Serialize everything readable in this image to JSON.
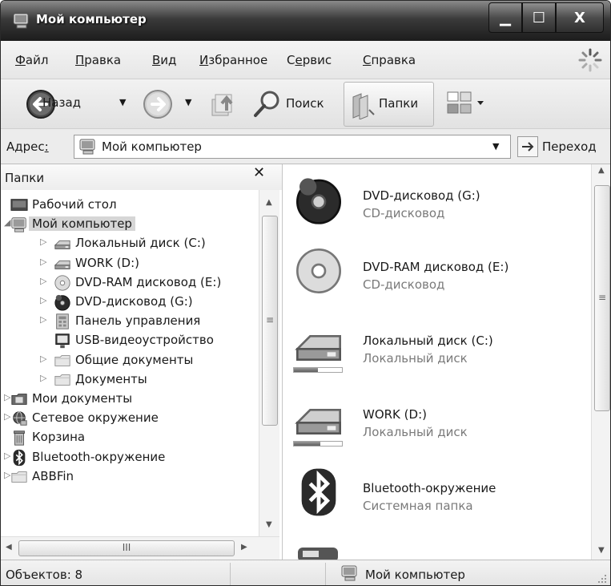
{
  "window": {
    "title": "Мой компьютер",
    "controls": {
      "minimize": "▁",
      "maximize": "☐",
      "close": "X"
    }
  },
  "menu": [
    {
      "key": "Ф",
      "rest": "айл"
    },
    {
      "key": "П",
      "rest": "равка"
    },
    {
      "key": "В",
      "rest": "ид"
    },
    {
      "key": "И",
      "rest": "збранное"
    },
    {
      "pre": "С",
      "key": "е",
      "rest": "рвис"
    },
    {
      "key": "С",
      "rest": "правка"
    }
  ],
  "toolbar": {
    "back_label": "Назад",
    "search_label": "Поиск",
    "folders_label": "Папки",
    "dropdown_glyph": "▼"
  },
  "address": {
    "label_pre": "Адрес",
    "label_key": ":",
    "value": "Мой компьютер",
    "dropdown_glyph": "▼",
    "go_label": "Переход"
  },
  "folders_pane": {
    "title": "Папки",
    "close_glyph": "✕",
    "tree": [
      {
        "label": "Рабочий стол",
        "icon": "desktop-icon",
        "level": 0,
        "twisty": ""
      },
      {
        "label": "Мой компьютер",
        "icon": "computer-icon",
        "level": 0,
        "twisty": "◢",
        "selected": true
      },
      {
        "label": "Локальный диск (C:)",
        "icon": "hard-drive-icon",
        "level": 1,
        "twisty": "▷"
      },
      {
        "label": "WORK (D:)",
        "icon": "hard-drive-icon",
        "level": 1,
        "twisty": "▷"
      },
      {
        "label": "DVD-RAM дисковод (E:)",
        "icon": "cd-drive-icon",
        "level": 1,
        "twisty": "▷"
      },
      {
        "label": "DVD-дисковод (G:)",
        "icon": "dvd-drive-icon",
        "level": 1,
        "twisty": "▷"
      },
      {
        "label": "Панель управления",
        "icon": "control-panel-icon",
        "level": 1,
        "twisty": "▷"
      },
      {
        "label": "USB-видеоустройство",
        "icon": "usb-video-icon",
        "level": 1,
        "twisty": ""
      },
      {
        "label": "Общие документы",
        "icon": "folder-icon",
        "level": 1,
        "twisty": "▷"
      },
      {
        "label": "Документы",
        "icon": "folder-icon",
        "level": 1,
        "twisty": "▷"
      },
      {
        "label": "Мои документы",
        "icon": "my-documents-icon",
        "level": 0,
        "twisty": "▷"
      },
      {
        "label": "Сетевое окружение",
        "icon": "network-icon",
        "level": 0,
        "twisty": "▷"
      },
      {
        "label": "Корзина",
        "icon": "recycle-bin-icon",
        "level": 0,
        "twisty": ""
      },
      {
        "label": "Bluetooth-окружение",
        "icon": "bluetooth-icon",
        "level": 0,
        "twisty": "▷"
      },
      {
        "label": "ABBFin",
        "icon": "folder-icon",
        "level": 0,
        "twisty": "▷"
      }
    ],
    "hscroll_grip": "III"
  },
  "items": [
    {
      "name": "DVD-дисковод (G:)",
      "type": "CD-дисковод",
      "icon": "dvd-drive-icon"
    },
    {
      "name": "DVD-RAM дисковод (E:)",
      "type": "CD-дисковод",
      "icon": "cd-drive-icon"
    },
    {
      "name": "Локальный диск (C:)",
      "type": "Локальный диск",
      "icon": "hard-drive-icon",
      "used_fraction": 0.5
    },
    {
      "name": "WORK (D:)",
      "type": "Локальный диск",
      "icon": "hard-drive-icon",
      "used_fraction": 0.55
    },
    {
      "name": "Bluetooth-окружение",
      "type": "Системная папка",
      "icon": "bluetooth-icon"
    }
  ],
  "scroll_glyphs": {
    "up": "▲",
    "down": "▼",
    "left": "◀",
    "right": "▶",
    "grip": "≡"
  },
  "status": {
    "count": "Объектов: 8",
    "location": "Мой компьютер"
  }
}
